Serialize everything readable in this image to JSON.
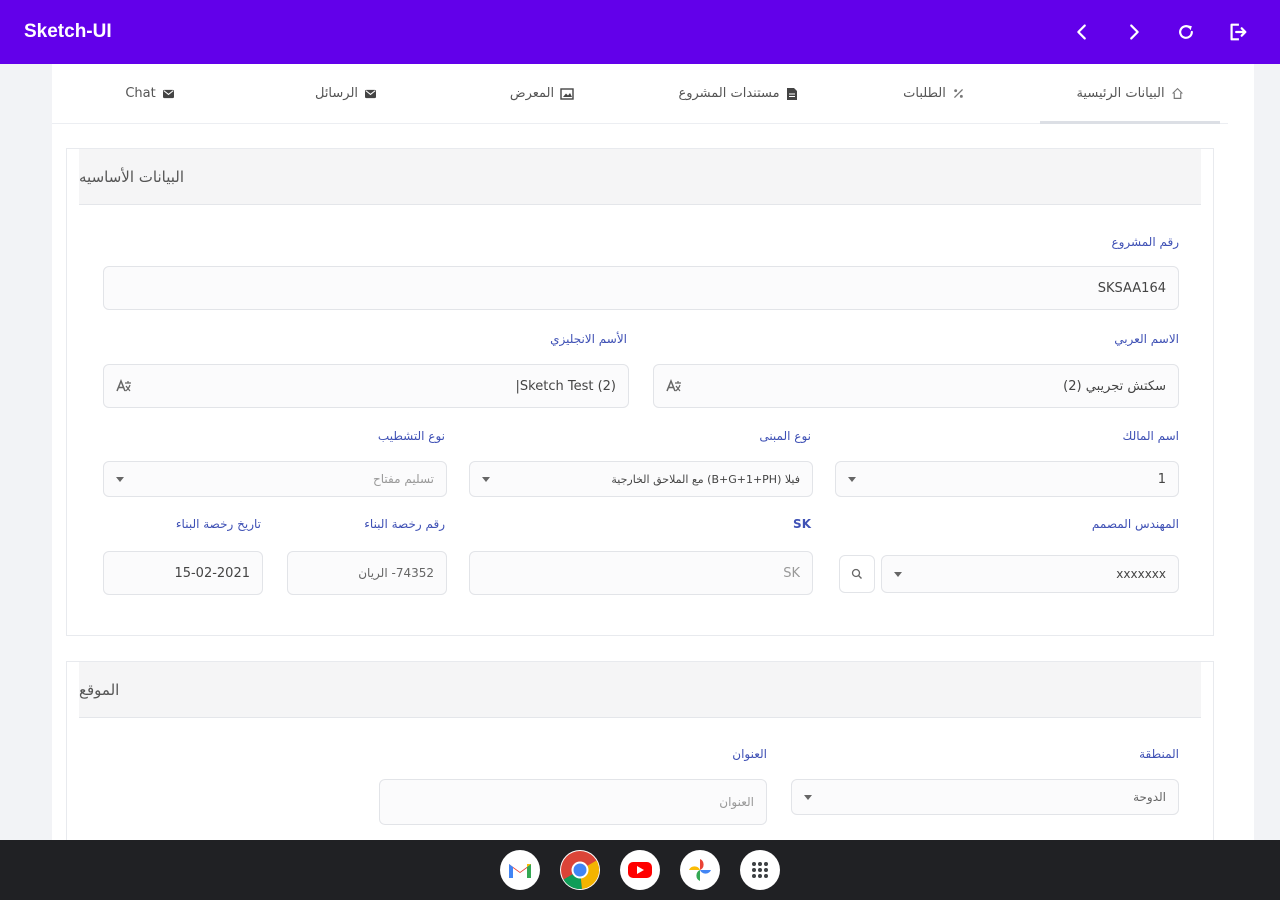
{
  "app": {
    "title": "Sketch-UI"
  },
  "tabs": [
    {
      "label": "البيانات الرئيسية",
      "icon": "home-icon"
    },
    {
      "label": "الطلبات",
      "icon": "percent-icon"
    },
    {
      "label": "مستندات المشروع",
      "icon": "document-icon"
    },
    {
      "label": "المعرض",
      "icon": "image-icon"
    },
    {
      "label": "الرسائل",
      "icon": "mail-icon"
    },
    {
      "label": "Chat",
      "icon": "mail-icon"
    }
  ],
  "basic_info": {
    "title": "البيانات الأساسيه",
    "project_number": {
      "label": "رقم المشروع",
      "value": "SKSAA164"
    },
    "arabic_name": {
      "label": "الاسم العربي",
      "value": "سكتش تجريبي (2)"
    },
    "english_name": {
      "label": "الأسم الانجليزي",
      "value": "Sketch Test (2)|"
    },
    "owner_name": {
      "label": "اسم المالك",
      "value": "1"
    },
    "building_type": {
      "label": "نوع المبنى",
      "value": "فيلا (B+G+1+PH) مع الملاحق الخارجية"
    },
    "finishing_type": {
      "label": "نوع التشطيب",
      "value": "تسليم مفتاح"
    },
    "designer_engineer": {
      "label": "المهندس المصمم",
      "value": "xxxxxxx"
    },
    "sk": {
      "label": "SK",
      "placeholder": "SK"
    },
    "permit_number": {
      "label": "رقم رخصة البناء",
      "value": "74352- الريان"
    },
    "permit_date": {
      "label": "تاريخ رخصة البناء",
      "value": "15-02-2021"
    }
  },
  "location": {
    "title": "الموقع",
    "region": {
      "label": "المنطقة",
      "value": "الدوحة"
    },
    "address": {
      "label": "العنوان",
      "placeholder": "العنوان"
    }
  },
  "colors": {
    "appbar": "#6200ea",
    "label": "#3f51b5"
  }
}
